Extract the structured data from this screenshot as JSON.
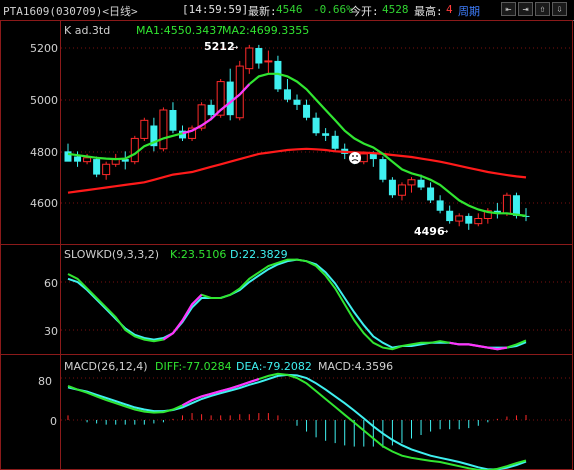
{
  "header": {
    "symbol": "PTA1609(030709)<日线>",
    "time": "[14:59:59]",
    "last_label": "最新:",
    "last_value": "4546",
    "change": "-0.66%",
    "open_label": "今开:",
    "open_value": "4528",
    "high_label": "最高:",
    "high_value": "4",
    "period_label": "周期",
    "tool_buttons": [
      "⇤",
      "⇥",
      "⇧",
      "⇩"
    ]
  },
  "price_panel": {
    "title": "K  ad.3td",
    "ma1_label": "MA1:4550.3437",
    "ma2_label": "MA2:4699.3355",
    "y_ticks": [
      "5200",
      "5000",
      "4800",
      "4600"
    ],
    "high_annotation": "5212",
    "low_annotation": "4496"
  },
  "kd_panel": {
    "title": "SLOWKD(9,3,3,2)",
    "k_label": "K:23.5106",
    "d_label": "D:22.3829",
    "y_ticks": [
      "60",
      "30"
    ]
  },
  "macd_panel": {
    "title": "MACD(26,12,4)",
    "diff_label": "DIFF:-77.0284",
    "dea_label": "DEA:-79.2082",
    "macd_label": "MACD:4.3596",
    "y_ticks": [
      "80",
      "0"
    ]
  },
  "colors": {
    "up": "#ff2a2a",
    "down": "#3ff0f0",
    "ma1": "#31e531",
    "ma2": "#ff1a1a",
    "kd_k": "#31e531",
    "kd_d": "#3ff0f0",
    "highlight": "#ff33ff",
    "grid": "#7a1010"
  },
  "chart_data": [
    {
      "type": "candlestick",
      "title": "K ad.3td",
      "y_range": [
        4480,
        5250
      ],
      "candles": [
        [
          4800,
          4830,
          4790,
          4760
        ],
        [
          4780,
          4800,
          4740,
          4760
        ],
        [
          4760,
          4790,
          4750,
          4775
        ],
        [
          4770,
          4780,
          4700,
          4710
        ],
        [
          4710,
          4760,
          4690,
          4750
        ],
        [
          4750,
          4790,
          4740,
          4770
        ],
        [
          4770,
          4800,
          4730,
          4760
        ],
        [
          4760,
          4860,
          4750,
          4850
        ],
        [
          4850,
          4930,
          4840,
          4920
        ],
        [
          4900,
          4930,
          4800,
          4820
        ],
        [
          4810,
          4970,
          4800,
          4960
        ],
        [
          4960,
          4990,
          4870,
          4880
        ],
        [
          4880,
          4900,
          4840,
          4850
        ],
        [
          4850,
          4900,
          4840,
          4890
        ],
        [
          4890,
          4990,
          4880,
          4980
        ],
        [
          4980,
          5000,
          4920,
          4940
        ],
        [
          4940,
          5080,
          4930,
          5070
        ],
        [
          5070,
          5120,
          4920,
          4940
        ],
        [
          4930,
          5150,
          4920,
          5130
        ],
        [
          5120,
          5212,
          5100,
          5200
        ],
        [
          5200,
          5212,
          5120,
          5140
        ],
        [
          5150,
          5190,
          5100,
          5150
        ],
        [
          5150,
          5170,
          5030,
          5040
        ],
        [
          5040,
          5080,
          4990,
          5000
        ],
        [
          5000,
          5020,
          4960,
          4980
        ],
        [
          4980,
          5000,
          4920,
          4930
        ],
        [
          4930,
          4950,
          4860,
          4870
        ],
        [
          4870,
          4890,
          4840,
          4860
        ],
        [
          4860,
          4880,
          4800,
          4810
        ],
        [
          4810,
          4830,
          4770,
          4790
        ],
        [
          4790,
          4800,
          4750,
          4760
        ],
        [
          4760,
          4800,
          4750,
          4790
        ],
        [
          4790,
          4800,
          4740,
          4770
        ],
        [
          4770,
          4780,
          4680,
          4690
        ],
        [
          4690,
          4700,
          4620,
          4630
        ],
        [
          4630,
          4680,
          4610,
          4670
        ],
        [
          4670,
          4700,
          4640,
          4690
        ],
        [
          4690,
          4710,
          4650,
          4660
        ],
        [
          4660,
          4680,
          4600,
          4610
        ],
        [
          4610,
          4630,
          4560,
          4570
        ],
        [
          4570,
          4590,
          4520,
          4530
        ],
        [
          4530,
          4560,
          4510,
          4550
        ],
        [
          4550,
          4560,
          4496,
          4520
        ],
        [
          4520,
          4560,
          4510,
          4540
        ],
        [
          4540,
          4580,
          4520,
          4570
        ],
        [
          4570,
          4600,
          4540,
          4560
        ],
        [
          4560,
          4640,
          4550,
          4630
        ],
        [
          4630,
          4640,
          4540,
          4550
        ],
        [
          4550,
          4580,
          4530,
          4546
        ]
      ],
      "ma1": [
        4790,
        4785,
        4780,
        4775,
        4772,
        4770,
        4772,
        4790,
        4820,
        4835,
        4850,
        4860,
        4870,
        4880,
        4900,
        4925,
        4960,
        4990,
        5020,
        5060,
        5090,
        5100,
        5100,
        5090,
        5070,
        5040,
        5000,
        4960,
        4920,
        4880,
        4850,
        4830,
        4815,
        4790,
        4760,
        4730,
        4715,
        4705,
        4690,
        4670,
        4640,
        4610,
        4590,
        4575,
        4565,
        4560,
        4560,
        4555,
        4550
      ],
      "ma2": [
        4640,
        4645,
        4650,
        4655,
        4660,
        4665,
        4670,
        4675,
        4680,
        4690,
        4700,
        4710,
        4715,
        4720,
        4730,
        4740,
        4750,
        4760,
        4770,
        4780,
        4790,
        4795,
        4800,
        4805,
        4808,
        4810,
        4808,
        4805,
        4800,
        4798,
        4796,
        4795,
        4793,
        4790,
        4786,
        4782,
        4778,
        4772,
        4766,
        4760,
        4752,
        4744,
        4736,
        4728,
        4720,
        4714,
        4708,
        4703,
        4699
      ],
      "ma1_name": "MA1",
      "ma2_name": "MA2"
    },
    {
      "type": "line",
      "title": "SLOWKD(9,3,3,2)",
      "y_range": [
        15,
        80
      ],
      "series": [
        {
          "name": "K",
          "values": [
            65,
            62,
            56,
            50,
            44,
            38,
            30,
            26,
            24,
            23,
            24,
            28,
            36,
            46,
            52,
            50,
            50,
            52,
            56,
            62,
            66,
            70,
            72,
            74,
            74,
            73,
            70,
            64,
            56,
            46,
            36,
            28,
            22,
            19,
            18,
            20,
            21,
            22,
            22,
            23,
            22,
            21,
            21,
            20,
            19,
            18,
            19,
            21,
            23.51
          ]
        },
        {
          "name": "D",
          "values": [
            62,
            60,
            55,
            49,
            43,
            37,
            31,
            27,
            25,
            24,
            25,
            28,
            35,
            44,
            50,
            50,
            50,
            52,
            55,
            60,
            64,
            68,
            71,
            73,
            74,
            73,
            71,
            66,
            59,
            50,
            41,
            33,
            26,
            22,
            19,
            20,
            20,
            21,
            22,
            22,
            22,
            21,
            21,
            20,
            19,
            19,
            19,
            20,
            22.38
          ]
        }
      ]
    },
    {
      "type": "line",
      "title": "MACD(26,12,4)",
      "y_range": [
        -100,
        95
      ],
      "series": [
        {
          "name": "DIFF",
          "values": [
            65,
            58,
            52,
            45,
            38,
            32,
            26,
            20,
            16,
            14,
            15,
            20,
            28,
            38,
            45,
            50,
            55,
            60,
            66,
            72,
            78,
            84,
            88,
            86,
            80,
            70,
            55,
            40,
            25,
            10,
            -5,
            -20,
            -35,
            -50,
            -60,
            -68,
            -72,
            -75,
            -78,
            -80,
            -84,
            -88,
            -92,
            -95,
            -96,
            -93,
            -88,
            -82,
            -77.03
          ]
        },
        {
          "name": "DEA",
          "values": [
            62,
            58,
            54,
            48,
            42,
            36,
            30,
            24,
            20,
            17,
            17,
            19,
            24,
            32,
            40,
            46,
            51,
            56,
            61,
            67,
            72,
            78,
            84,
            86,
            85,
            80,
            70,
            58,
            45,
            32,
            18,
            3,
            -12,
            -26,
            -38,
            -48,
            -56,
            -62,
            -68,
            -72,
            -76,
            -80,
            -85,
            -90,
            -94,
            -94,
            -91,
            -86,
            -79.21
          ]
        },
        {
          "name": "MACD",
          "values": [
            4,
            0,
            -2,
            -3,
            -4,
            -4,
            -4,
            -4,
            -4,
            -3,
            -2,
            1,
            4,
            6,
            5,
            4,
            4,
            4,
            5,
            5,
            6,
            6,
            4,
            0,
            -5,
            -10,
            -15,
            -18,
            -20,
            -22,
            -23,
            -23,
            -23,
            -24,
            -22,
            -20,
            -16,
            -13,
            -10,
            -8,
            -8,
            -8,
            -7,
            -5,
            -2,
            1,
            3,
            4,
            4.36
          ]
        }
      ]
    }
  ]
}
